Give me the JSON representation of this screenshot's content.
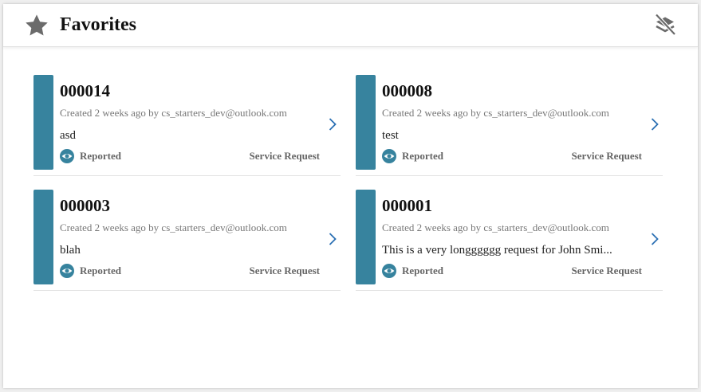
{
  "header": {
    "title": "Favorites",
    "title_icon": "star-icon",
    "action_icon": "remove-favorites-icon"
  },
  "colors": {
    "accent_bar": "#37839e",
    "chevron": "#2a6fb3"
  },
  "cards": [
    {
      "number": "000014",
      "meta": "Created 2 weeks ago by cs_starters_dev@outlook.com",
      "description": "asd",
      "status": "Reported",
      "type": "Service Request"
    },
    {
      "number": "000008",
      "meta": "Created 2 weeks ago by cs_starters_dev@outlook.com",
      "description": "test",
      "status": "Reported",
      "type": "Service Request"
    },
    {
      "number": "000003",
      "meta": "Created 2 weeks ago by cs_starters_dev@outlook.com",
      "description": "blah",
      "status": "Reported",
      "type": "Service Request"
    },
    {
      "number": "000001",
      "meta": "Created 2 weeks ago by cs_starters_dev@outlook.com",
      "description": "This is a very longggggg request for John Smi...",
      "status": "Reported",
      "type": "Service Request"
    }
  ]
}
